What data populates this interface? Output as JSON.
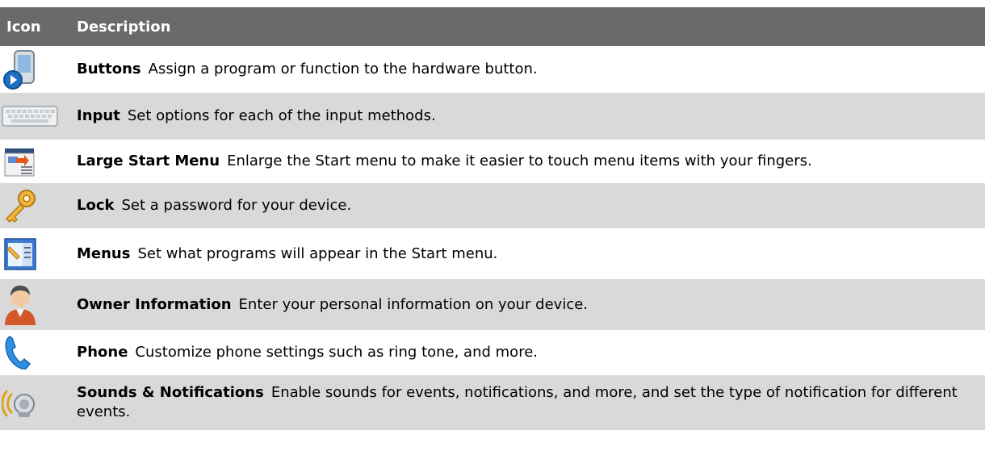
{
  "header": {
    "icon": "Icon",
    "description": "Description"
  },
  "rows": [
    {
      "icon": "buttons-icon",
      "name": "Buttons",
      "desc": "Assign a program or function to the hardware button."
    },
    {
      "icon": "input-icon",
      "name": "Input",
      "desc": "Set options for each of the input methods."
    },
    {
      "icon": "large-start-menu-icon",
      "name": "Large Start Menu",
      "desc": "Enlarge the Start menu to make it easier to touch menu items with your fingers."
    },
    {
      "icon": "lock-icon",
      "name": "Lock",
      "desc": "Set a password for your device."
    },
    {
      "icon": "menus-icon",
      "name": "Menus",
      "desc": "Set what programs will appear in the Start menu."
    },
    {
      "icon": "owner-information-icon",
      "name": "Owner Information",
      "desc": "Enter your personal information on your device."
    },
    {
      "icon": "phone-icon",
      "name": "Phone",
      "desc": "Customize phone settings such as ring tone, and more."
    },
    {
      "icon": "sounds-notifications-icon",
      "name": "Sounds & Notifications",
      "desc": "Enable sounds for events, notifications, and more, and set the type of notification for different events."
    }
  ]
}
